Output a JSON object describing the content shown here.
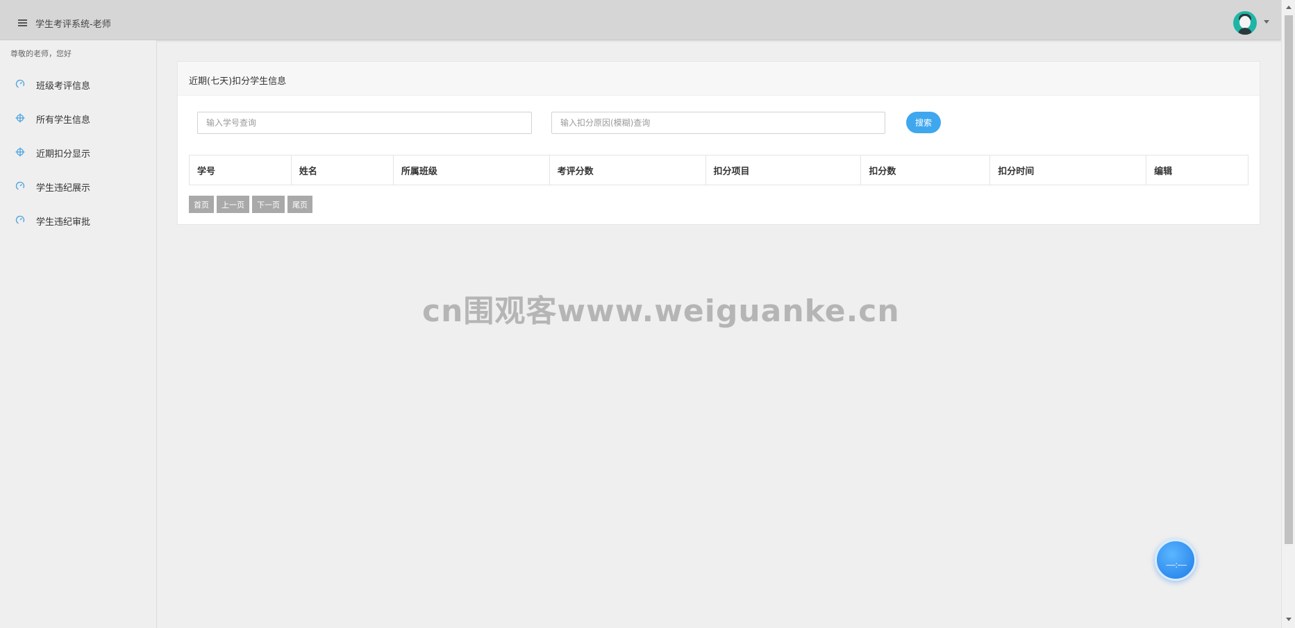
{
  "header": {
    "title": "学生考评系统-老师"
  },
  "sidebar": {
    "greeting": "尊敬的老师，您好",
    "items": [
      {
        "label": "班级考评信息",
        "icon": "gauge-icon"
      },
      {
        "label": "所有学生信息",
        "icon": "crosshair-icon"
      },
      {
        "label": "近期扣分显示",
        "icon": "crosshair-icon"
      },
      {
        "label": "学生违纪展示",
        "icon": "gauge-icon"
      },
      {
        "label": "学生违纪审批",
        "icon": "gauge-icon"
      }
    ]
  },
  "panel": {
    "title": "近期(七天)扣分学生信息",
    "student_id_placeholder": "输入学号查询",
    "reason_placeholder": "输入扣分原因(模糊)查询",
    "search_label": "搜索",
    "columns": [
      "学号",
      "姓名",
      "所属班级",
      "考评分数",
      "扣分项目",
      "扣分数",
      "扣分时间",
      "编辑"
    ],
    "pager": {
      "first": "首页",
      "prev": "上一页",
      "next": "下一页",
      "last": "尾页"
    }
  },
  "watermark": "cn围观客www.weiguanke.cn",
  "colors": {
    "accent": "#3fa7ee",
    "icon_blue": "#4aa3df",
    "topbar": "#d6d6d6"
  }
}
